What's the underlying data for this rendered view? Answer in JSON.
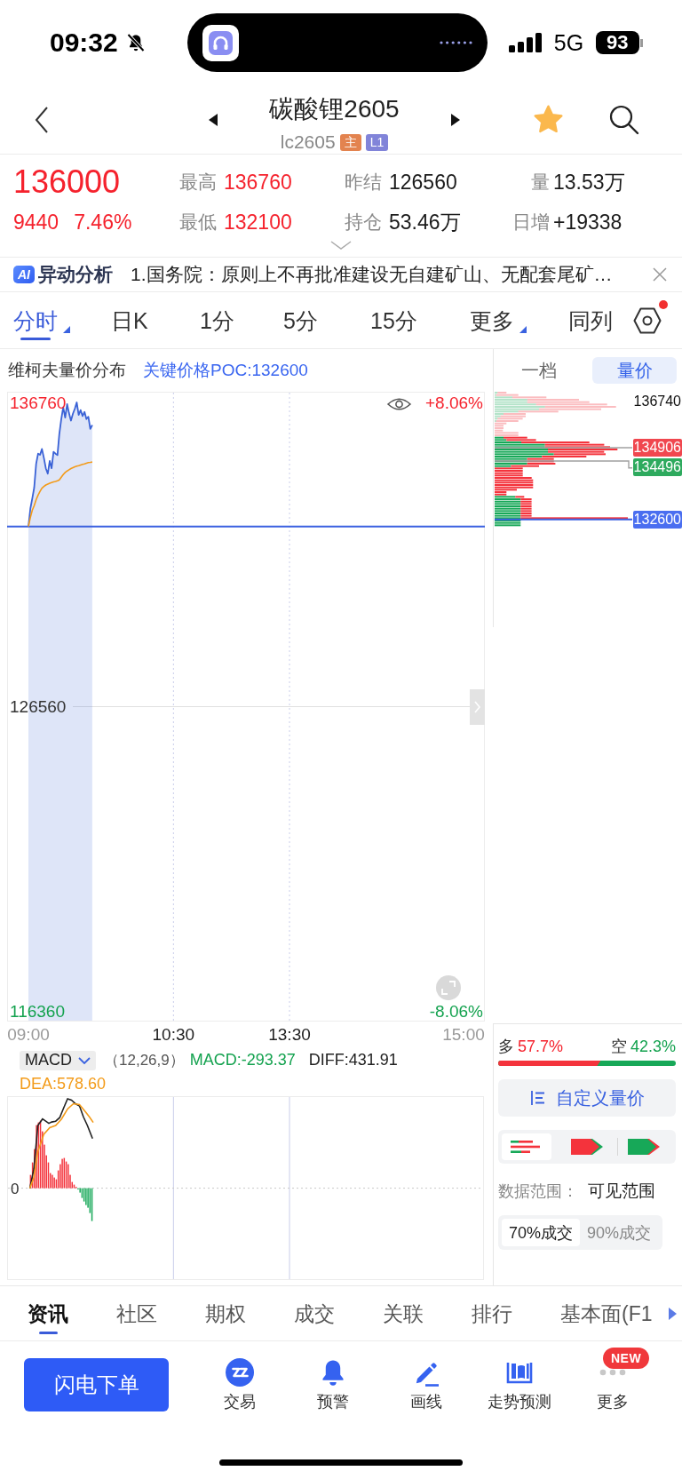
{
  "status_bar": {
    "time": "09:32",
    "silent": true,
    "network": "5G",
    "battery": "93"
  },
  "header": {
    "title": "碳酸锂2605",
    "code": "lc2605",
    "tags": [
      {
        "text": "主",
        "color": "#e3834f"
      },
      {
        "text": "L1",
        "color": "#8184d9"
      }
    ],
    "favorite": true
  },
  "quote": {
    "price": "136000",
    "change": "9440",
    "change_percent": "7.46%",
    "stats": [
      {
        "label": "最高",
        "value": "136760",
        "color": "#f5222d"
      },
      {
        "label": "昨结",
        "value": "126560",
        "color": "#1a1a1a"
      },
      {
        "label": "量",
        "value": "13.53万",
        "color": "#1a1a1a"
      },
      {
        "label": "最低",
        "value": "132100",
        "color": "#f5222d"
      },
      {
        "label": "持仓",
        "value": "53.46万",
        "color": "#1a1a1a"
      },
      {
        "label": "日增",
        "value": "+19338",
        "color": "#1a1a1a"
      }
    ]
  },
  "alert_bar": {
    "badge": "AI",
    "title": "异动分析",
    "text": "1.国务院：原则上不再批准建设无自建矿山、无配套尾矿…"
  },
  "period_tabs": [
    {
      "label": "分时",
      "selected": true,
      "dropdown": true
    },
    {
      "label": "日K",
      "selected": false,
      "dropdown": false
    },
    {
      "label": "1分",
      "selected": false,
      "dropdown": false
    },
    {
      "label": "5分",
      "selected": false,
      "dropdown": false
    },
    {
      "label": "15分",
      "selected": false,
      "dropdown": false
    },
    {
      "label": "更多",
      "selected": false,
      "dropdown": true
    },
    {
      "label": "同列",
      "selected": false,
      "dropdown": false
    }
  ],
  "settings": {
    "notification": true
  },
  "chart_panel": {
    "title": "维柯夫量价分布",
    "poc": "关键价格POC:132600",
    "percent_high": "+8.06%",
    "percent_low": "-8.06%",
    "chart_data": {
      "type": "line",
      "categories": [
        "09:00",
        null,
        null,
        null,
        null,
        null,
        null,
        null,
        null,
        null,
        null,
        null,
        null,
        null,
        null,
        null,
        null,
        null,
        null,
        null,
        null,
        null,
        null,
        null,
        null,
        null,
        null,
        null,
        null,
        null,
        null,
        null,
        null,
        null,
        null,
        null,
        null,
        null,
        null,
        null,
        null,
        null,
        null,
        null,
        null,
        null,
        null,
        null,
        null,
        null,
        null,
        null,
        null,
        null,
        null,
        null,
        null,
        null,
        null,
        null,
        null,
        null,
        null,
        null,
        null,
        null,
        null,
        null,
        null,
        null,
        null,
        null,
        null,
        null,
        null,
        "10:30",
        null,
        null,
        null,
        null,
        null,
        null,
        null,
        null,
        null,
        null,
        null,
        null,
        null,
        null,
        null,
        null,
        null,
        null,
        null,
        null,
        null,
        null,
        null,
        null,
        null,
        null,
        null,
        null,
        null,
        null,
        null,
        null,
        null,
        null,
        null,
        null,
        null,
        null,
        null,
        null,
        null,
        null,
        null,
        null,
        null,
        null,
        null,
        null,
        null,
        null,
        null,
        null,
        null,
        null,
        null,
        null,
        null,
        null,
        null,
        "13:30",
        null,
        null,
        null,
        null,
        null,
        null,
        null,
        null,
        null,
        null,
        null,
        null,
        null,
        null,
        null,
        null,
        null,
        null,
        null,
        null,
        null,
        null,
        null,
        null,
        null,
        null,
        null,
        null,
        null,
        null,
        null,
        null,
        null,
        null,
        null,
        null,
        null,
        null,
        null,
        null,
        null,
        null,
        null,
        null,
        null,
        null,
        null,
        null,
        null,
        null,
        null,
        null,
        null,
        null,
        null,
        null,
        null,
        null,
        null,
        null,
        null,
        null,
        null,
        null,
        null,
        null,
        null,
        null,
        null,
        null,
        null,
        null,
        null,
        null,
        null,
        null,
        null,
        null,
        null,
        null,
        null,
        null,
        null,
        null,
        null,
        null,
        null,
        null,
        null,
        "15:00"
      ],
      "series": [
        {
          "color": "#3a62d6",
          "values": [
            132600,
            133200,
            133550,
            133900,
            134700,
            135040,
            135000,
            135200,
            134900,
            134550,
            134370,
            134800,
            134550,
            135100,
            135040,
            134990,
            135700,
            136200,
            136600,
            136250,
            136700,
            136400,
            136150,
            136380,
            136550,
            136760,
            136340,
            136500,
            136300,
            136440,
            136200,
            136280,
            135870,
            136000,
            null,
            null,
            null,
            null,
            null,
            null,
            null,
            null,
            null,
            null,
            null,
            null,
            null,
            null,
            null,
            null,
            null,
            null,
            null,
            null,
            null,
            null,
            null,
            null,
            null,
            null,
            null,
            null,
            null,
            null,
            null,
            null,
            null,
            null,
            null,
            null,
            null,
            null,
            null,
            null,
            null,
            null,
            null,
            null,
            null,
            null,
            null,
            null,
            null,
            null,
            null,
            null,
            null,
            null,
            null,
            null,
            null,
            null,
            null,
            null,
            null,
            null,
            null,
            null,
            null,
            null,
            null,
            null,
            null,
            null,
            null,
            null,
            null,
            null,
            null,
            null,
            null,
            null,
            null,
            null,
            null,
            null,
            null,
            null,
            null,
            null,
            null,
            null,
            null,
            null,
            null,
            null,
            null,
            null,
            null,
            null,
            null,
            null,
            null,
            null,
            null,
            null,
            null,
            null,
            null,
            null,
            null,
            null,
            null,
            null,
            null,
            null,
            null,
            null,
            null,
            null,
            null,
            null,
            null,
            null,
            null,
            null,
            null,
            null,
            null,
            null,
            null,
            null,
            null,
            null,
            null,
            null,
            null,
            null,
            null,
            null,
            null,
            null,
            null,
            null,
            null,
            null,
            null,
            null,
            null,
            null,
            null,
            null,
            null,
            null,
            null,
            null,
            null,
            null,
            null,
            null,
            null,
            null,
            null,
            null,
            null,
            null,
            null,
            null,
            null,
            null,
            null,
            null,
            null,
            null,
            null,
            null,
            null,
            null,
            null,
            null,
            null,
            null,
            null,
            null,
            null,
            null,
            null,
            null,
            null,
            null,
            null,
            null,
            null,
            null,
            null,
            null
          ]
        },
        {
          "color": "#f39b19",
          "values": [
            132600,
            132900,
            133150,
            133300,
            133500,
            133650,
            133780,
            133880,
            133940,
            133990,
            134020,
            134050,
            134070,
            134090,
            134110,
            134130,
            134160,
            134250,
            134340,
            134410,
            134460,
            134500,
            134540,
            134570,
            134600,
            134620,
            134640,
            134660,
            134680,
            134700,
            134720,
            134740,
            134750,
            134760,
            null,
            null,
            null,
            null,
            null,
            null,
            null,
            null,
            null,
            null,
            null,
            null,
            null,
            null,
            null,
            null,
            null,
            null,
            null,
            null,
            null,
            null,
            null,
            null,
            null,
            null,
            null,
            null,
            null,
            null,
            null,
            null,
            null,
            null,
            null,
            null,
            null,
            null,
            null,
            null,
            null,
            null,
            null,
            null,
            null,
            null,
            null,
            null,
            null,
            null,
            null,
            null,
            null,
            null,
            null,
            null,
            null,
            null,
            null,
            null,
            null,
            null,
            null,
            null,
            null,
            null,
            null,
            null,
            null,
            null,
            null,
            null,
            null,
            null,
            null,
            null,
            null,
            null,
            null,
            null,
            null,
            null,
            null,
            null,
            null,
            null,
            null,
            null,
            null,
            null,
            null,
            null,
            null,
            null,
            null,
            null,
            null,
            null,
            null,
            null,
            null,
            null,
            null,
            null,
            null,
            null,
            null,
            null,
            null,
            null,
            null,
            null,
            null,
            null,
            null,
            null,
            null,
            null,
            null,
            null,
            null,
            null,
            null,
            null,
            null,
            null,
            null,
            null,
            null,
            null,
            null,
            null,
            null,
            null,
            null,
            null,
            null,
            null,
            null,
            null,
            null,
            null,
            null,
            null,
            null,
            null,
            null,
            null,
            null,
            null,
            null,
            null,
            null,
            null,
            null,
            null,
            null,
            null,
            null,
            null,
            null,
            null,
            null,
            null,
            null,
            null,
            null,
            null,
            null,
            null,
            null,
            null,
            null,
            null,
            null,
            null,
            null,
            null,
            null,
            null,
            null,
            null,
            null,
            null,
            null,
            null,
            null,
            null,
            null,
            null,
            null,
            null
          ]
        }
      ],
      "ylim": [
        116003,
        137117
      ],
      "yticks": [
        {
          "value": 116360,
          "label": "116360"
        },
        {
          "value": 126560,
          "label": "126560"
        },
        {
          "value": 136760,
          "label": "136760"
        }
      ],
      "ref_lines": [
        {
          "axis": "y",
          "value": 132600,
          "color": "#3a5fe0"
        },
        {
          "axis": "y",
          "value": 126560,
          "color": "#e0e0e0"
        }
      ]
    }
  },
  "macd": {
    "indicator": "MACD",
    "params": "（12,26,9）",
    "macd": "MACD:-293.37",
    "diff": "DIFF:431.91",
    "dea": "DEA:578.60",
    "zero_label": "0"
  },
  "side_panel": {
    "tabs": [
      {
        "label": "一档",
        "selected": false
      },
      {
        "label": "量价",
        "selected": true
      }
    ],
    "price_tags": [
      {
        "text": "136740",
        "kind": "plain"
      },
      {
        "text": "134906",
        "kind": "upper"
      },
      {
        "text": "134496",
        "kind": "lower"
      },
      {
        "text": "132600",
        "kind": "poc"
      }
    ],
    "sentiment": {
      "long_label": "多",
      "long_value": "57.7%",
      "short_label": "空",
      "short_value": "42.3%",
      "level": 0.577
    },
    "custom_button": "自定义量价",
    "display_modes": [
      {
        "kind": "bars",
        "selected": true
      },
      {
        "kind": "red_arrow",
        "selected": false
      },
      {
        "kind": "green_arrow",
        "selected": false
      }
    ],
    "range_label": "数据范围：",
    "range_value": "可见范围",
    "volume_options": [
      {
        "label": "70%成交",
        "selected": true
      },
      {
        "label": "90%成交",
        "selected": false
      }
    ]
  },
  "bottom_tabs": [
    {
      "label": "资讯",
      "selected": true
    },
    {
      "label": "社区",
      "selected": false
    },
    {
      "label": "期权",
      "selected": false
    },
    {
      "label": "成交",
      "selected": false
    },
    {
      "label": "关联",
      "selected": false
    },
    {
      "label": "排行",
      "selected": false
    },
    {
      "label": "基本面(F1",
      "selected": false
    }
  ],
  "toolbar": {
    "order_button": "闪电下单",
    "items": [
      {
        "label": "交易",
        "kind": "trade"
      },
      {
        "label": "预警",
        "kind": "alert"
      },
      {
        "label": "画线",
        "kind": "draw"
      },
      {
        "label": "走势预测",
        "kind": "forecast"
      },
      {
        "label": "更多",
        "kind": "more",
        "badge": "NEW"
      }
    ]
  }
}
